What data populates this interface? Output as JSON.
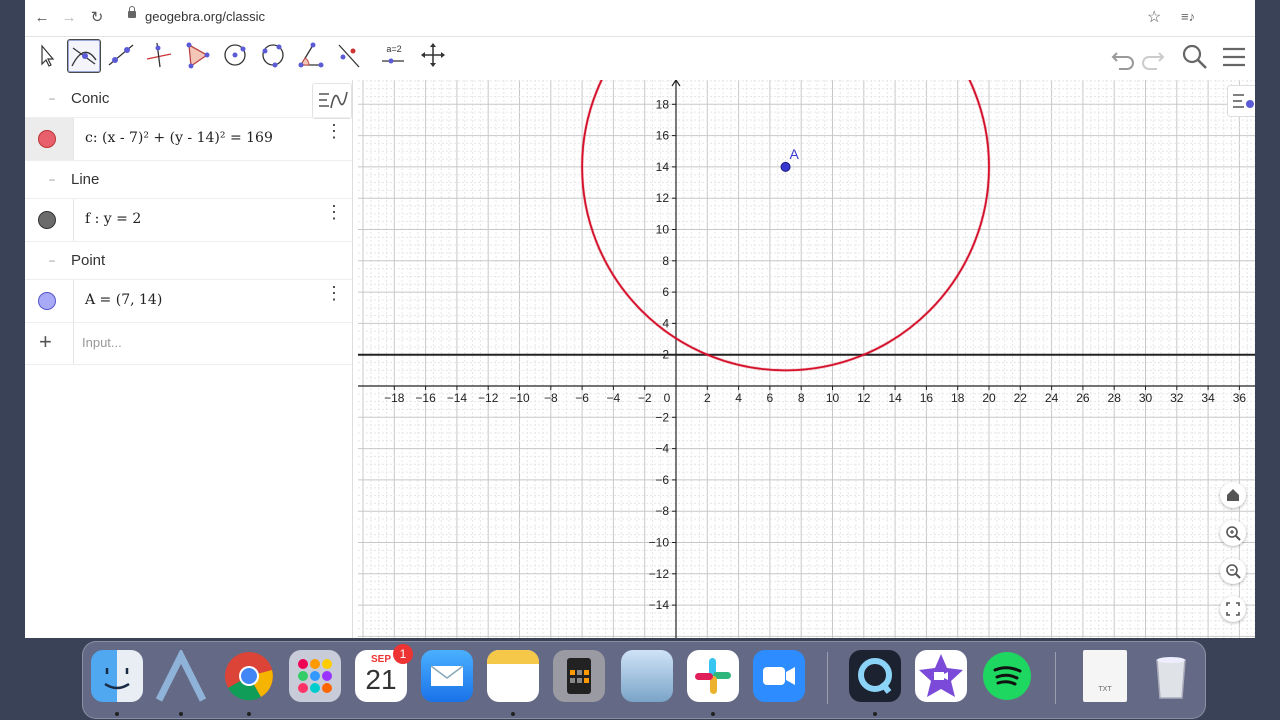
{
  "browser": {
    "url": "geogebra.org/classic",
    "icons": [
      "back-icon",
      "forward-icon",
      "reload-icon",
      "lock-icon",
      "star-icon",
      "media-icon"
    ]
  },
  "toolbar": {
    "tools": [
      "move-tool",
      "intersect-tool",
      "line-tool",
      "perpendicular-line-tool",
      "polygon-tool",
      "circle-center-point-tool",
      "circle-three-points-tool",
      "angle-tool",
      "reflect-tool",
      "slider-tool",
      "move-graphics-view-tool"
    ],
    "slider_label": "a=2",
    "right_icons": [
      "undo-icon",
      "redo-icon",
      "search-icon",
      "menu-icon"
    ]
  },
  "algebra": {
    "groups": [
      {
        "name": "Conic",
        "items": [
          {
            "expr": "c: (x - 7)² + (y - 14)² = 169",
            "color": "#e8606b"
          }
        ]
      },
      {
        "name": "Line",
        "items": [
          {
            "expr": "f : y = 2",
            "color": "#6b6b6b"
          }
        ]
      },
      {
        "name": "Point",
        "items": [
          {
            "expr": "A = (7, 14)",
            "color": "#9b9df5"
          }
        ]
      }
    ],
    "input_placeholder": "Input..."
  },
  "graphics": {
    "x_ticks": [
      "−18",
      "−16",
      "−14",
      "−12",
      "−10",
      "−8",
      "−6",
      "−4",
      "−2",
      "0",
      "2",
      "4",
      "6",
      "8",
      "10",
      "12",
      "14",
      "16",
      "18",
      "20",
      "22",
      "24",
      "26",
      "28",
      "30",
      "32",
      "34",
      "36"
    ],
    "y_ticks_pos": [
      "18",
      "16",
      "14",
      "12",
      "10",
      "8",
      "6",
      "4",
      "2"
    ],
    "y_ticks_neg": [
      "−2",
      "−4",
      "−6",
      "−8",
      "−10",
      "−12",
      "−14"
    ],
    "point_label": "A",
    "circle_color": "#d4102a",
    "point_color": "#3838d0",
    "line_color": "#222222",
    "controls": [
      "home-icon",
      "zoom-in-icon",
      "zoom-out-icon",
      "fullscreen-icon"
    ]
  },
  "chart_data": {
    "type": "scatter",
    "circle": {
      "center": [
        7,
        14
      ],
      "radius": 13
    },
    "line": {
      "y": 2
    },
    "points": [
      {
        "name": "A",
        "x": 7,
        "y": 14
      }
    ],
    "xlim": [
      -20,
      37
    ],
    "ylim": [
      -16,
      19
    ],
    "grid": true
  },
  "dock": {
    "apps": [
      "finder-icon",
      "geogebra-icon",
      "chrome-icon",
      "launchpad-icon",
      "calendar-icon",
      "mail-icon",
      "notes-icon",
      "calculator-icon",
      "preview-icon",
      "slack-icon",
      "zoom-icon",
      "quicktime-icon",
      "imovie-icon",
      "spotify-icon",
      "text-file-icon",
      "trash-icon"
    ],
    "calendar_month": "SEP",
    "calendar_day": "21",
    "badge": "1",
    "txt_label": "TXT"
  }
}
